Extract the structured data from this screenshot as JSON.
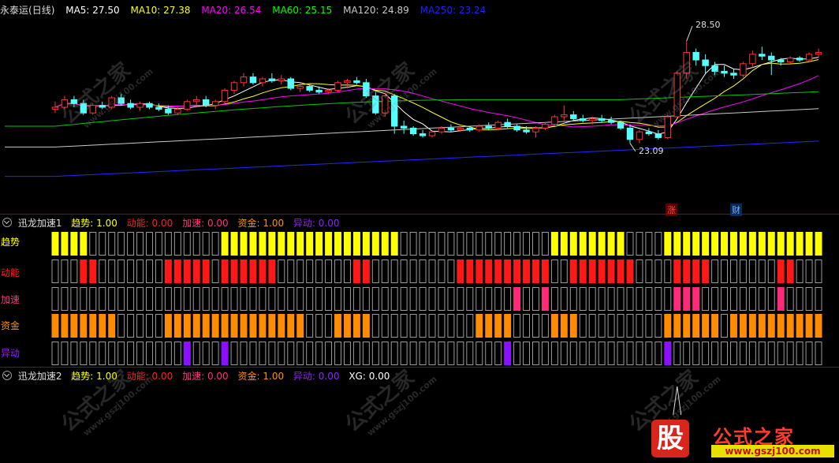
{
  "stock": {
    "name": "永泰运",
    "period": "(日线)"
  },
  "ma_legend": [
    {
      "label": "MA5: 27.50",
      "color": "#ffffff"
    },
    {
      "label": "MA10: 27.38",
      "color": "#ffff00"
    },
    {
      "label": "MA20: 26.54",
      "color": "#ff00ff"
    },
    {
      "label": "MA60: 25.15",
      "color": "#00ff00"
    },
    {
      "label": "MA120: 24.89",
      "color": "#c8c8c8"
    },
    {
      "label": "MA250: 23.24",
      "color": "#2020ff"
    }
  ],
  "annotations": {
    "high": "28.50",
    "low": "23.09",
    "tag_zhang": "涨",
    "tag_cai": "财"
  },
  "panel1": {
    "title": "迅龙加速1",
    "stats": [
      {
        "label": "趋势: 1.00",
        "color": "#ffff00"
      },
      {
        "label": "动能: 0.00",
        "color": "#ff2020"
      },
      {
        "label": "加速: 0.00",
        "color": "#ff3080"
      },
      {
        "label": "资金: 1.00",
        "color": "#ff9000"
      },
      {
        "label": "异动: 0.00",
        "color": "#9020ff"
      }
    ],
    "row_labels": [
      {
        "label": "趋势",
        "color": "#ffff00"
      },
      {
        "label": "动能",
        "color": "#ff2020"
      },
      {
        "label": "加速",
        "color": "#ff3080"
      },
      {
        "label": "资金",
        "color": "#ff9000"
      },
      {
        "label": "异动",
        "color": "#9020ff"
      }
    ]
  },
  "panel2": {
    "title": "迅龙加速2",
    "stats": [
      {
        "label": "趋势: 1.00",
        "color": "#ffff00"
      },
      {
        "label": "动能: 0.00",
        "color": "#ff2020"
      },
      {
        "label": "加速: 0.00",
        "color": "#ff3080"
      },
      {
        "label": "资金: 1.00",
        "color": "#ff9000"
      },
      {
        "label": "异动: 0.00",
        "color": "#9020ff"
      },
      {
        "label": "XG: 0.00",
        "color": "#ffffff"
      }
    ]
  },
  "watermark": {
    "text": "公式之家",
    "url": "www.gszj100.com"
  },
  "logo": {
    "icon_char": "股",
    "name": "公式之家",
    "url": "www.gszj100.com"
  },
  "chart_data": {
    "type": "candlestick",
    "bar_count": 82,
    "ylim": [
      21.0,
      29.5
    ],
    "ohlc": [
      [
        24.9,
        25.3,
        24.7,
        25.0
      ],
      [
        25.0,
        25.6,
        24.9,
        25.4
      ],
      [
        25.4,
        25.6,
        25.0,
        25.2
      ],
      [
        25.2,
        25.4,
        24.6,
        24.7
      ],
      [
        24.7,
        25.2,
        24.6,
        25.1
      ],
      [
        25.1,
        25.3,
        24.9,
        25.0
      ],
      [
        25.0,
        25.6,
        24.9,
        25.5
      ],
      [
        25.5,
        25.7,
        25.1,
        25.2
      ],
      [
        25.2,
        25.4,
        24.9,
        25.0
      ],
      [
        25.0,
        25.3,
        24.8,
        25.2
      ],
      [
        25.2,
        25.3,
        24.9,
        25.0
      ],
      [
        25.0,
        25.2,
        24.8,
        24.9
      ],
      [
        24.9,
        25.1,
        24.6,
        24.7
      ],
      [
        24.7,
        25.0,
        24.6,
        24.9
      ],
      [
        24.9,
        25.4,
        24.8,
        25.3
      ],
      [
        25.3,
        25.6,
        25.1,
        25.4
      ],
      [
        25.4,
        25.6,
        25.0,
        25.1
      ],
      [
        25.1,
        25.4,
        24.9,
        25.3
      ],
      [
        25.3,
        26.0,
        25.2,
        25.9
      ],
      [
        25.9,
        26.4,
        25.7,
        26.3
      ],
      [
        26.3,
        26.8,
        26.1,
        26.6
      ],
      [
        26.6,
        26.8,
        26.2,
        26.3
      ],
      [
        26.3,
        26.6,
        26.1,
        26.5
      ],
      [
        26.5,
        26.8,
        26.3,
        26.4
      ],
      [
        26.4,
        26.7,
        26.2,
        26.5
      ],
      [
        26.5,
        26.6,
        25.9,
        26.0
      ],
      [
        26.0,
        26.3,
        25.8,
        26.1
      ],
      [
        26.1,
        26.2,
        25.8,
        25.9
      ],
      [
        25.9,
        26.1,
        25.7,
        25.8
      ],
      [
        25.8,
        26.0,
        25.7,
        25.9
      ],
      [
        25.9,
        26.4,
        25.8,
        26.3
      ],
      [
        26.3,
        26.5,
        26.0,
        26.4
      ],
      [
        26.4,
        26.6,
        26.2,
        26.3
      ],
      [
        26.3,
        26.5,
        25.5,
        25.6
      ],
      [
        25.6,
        25.8,
        24.6,
        24.7
      ],
      [
        24.7,
        25.8,
        24.5,
        25.6
      ],
      [
        25.6,
        25.7,
        23.6,
        24.0
      ],
      [
        24.0,
        24.3,
        23.6,
        23.9
      ],
      [
        23.9,
        24.0,
        23.5,
        23.6
      ],
      [
        23.6,
        23.8,
        23.4,
        23.5
      ],
      [
        23.5,
        23.8,
        23.4,
        23.7
      ],
      [
        23.7,
        24.0,
        23.6,
        23.9
      ],
      [
        23.9,
        24.1,
        23.7,
        23.8
      ],
      [
        23.8,
        24.0,
        23.7,
        23.9
      ],
      [
        23.9,
        24.0,
        23.7,
        23.8
      ],
      [
        23.8,
        24.1,
        23.7,
        24.0
      ],
      [
        24.0,
        24.2,
        23.8,
        23.9
      ],
      [
        23.9,
        24.3,
        23.8,
        24.2
      ],
      [
        24.2,
        24.4,
        23.9,
        24.0
      ],
      [
        24.0,
        24.1,
        23.7,
        23.8
      ],
      [
        23.8,
        24.0,
        23.6,
        23.7
      ],
      [
        23.7,
        24.0,
        23.4,
        23.9
      ],
      [
        23.9,
        24.2,
        23.8,
        24.1
      ],
      [
        24.1,
        24.6,
        24.0,
        24.5
      ],
      [
        24.5,
        25.1,
        24.3,
        24.6
      ],
      [
        24.6,
        24.8,
        24.3,
        24.4
      ],
      [
        24.4,
        24.6,
        24.2,
        24.3
      ],
      [
        24.3,
        24.5,
        24.1,
        24.4
      ],
      [
        24.4,
        24.6,
        24.2,
        24.3
      ],
      [
        24.3,
        24.5,
        24.1,
        24.2
      ],
      [
        24.2,
        24.3,
        23.8,
        23.9
      ],
      [
        23.9,
        24.1,
        23.1,
        23.3
      ],
      [
        23.3,
        23.8,
        23.1,
        23.7
      ],
      [
        23.7,
        23.9,
        23.5,
        23.6
      ],
      [
        23.6,
        23.8,
        23.3,
        23.4
      ],
      [
        23.4,
        24.6,
        23.3,
        24.5
      ],
      [
        24.5,
        26.9,
        24.4,
        26.8
      ],
      [
        26.8,
        28.5,
        26.5,
        27.9
      ],
      [
        27.9,
        28.1,
        27.2,
        27.5
      ],
      [
        27.5,
        27.8,
        26.8,
        27.2
      ],
      [
        27.2,
        27.4,
        26.7,
        26.9
      ],
      [
        26.9,
        27.2,
        26.6,
        26.8
      ],
      [
        26.8,
        27.0,
        26.5,
        26.7
      ],
      [
        26.7,
        27.4,
        26.6,
        27.3
      ],
      [
        27.3,
        28.0,
        27.1,
        27.8
      ],
      [
        27.8,
        28.2,
        27.5,
        27.7
      ],
      [
        27.7,
        27.9,
        26.7,
        27.5
      ],
      [
        27.5,
        27.6,
        27.2,
        27.4
      ],
      [
        27.4,
        27.7,
        27.3,
        27.6
      ],
      [
        27.6,
        27.7,
        27.4,
        27.5
      ],
      [
        27.5,
        27.9,
        27.4,
        27.8
      ],
      [
        27.8,
        28.1,
        27.6,
        27.9
      ]
    ],
    "signal_rows": [
      {
        "name": "趋势",
        "color": "#ffff00",
        "values": [
          1,
          1,
          1,
          1,
          0,
          0,
          0,
          0,
          0,
          0,
          0,
          0,
          0,
          0,
          0,
          0,
          0,
          0,
          1,
          1,
          1,
          1,
          1,
          1,
          1,
          1,
          1,
          1,
          1,
          1,
          1,
          1,
          1,
          1,
          1,
          1,
          1,
          0,
          0,
          0,
          0,
          0,
          0,
          0,
          0,
          0,
          0,
          0,
          0,
          0,
          0,
          0,
          0,
          1,
          1,
          1,
          1,
          1,
          1,
          1,
          1,
          0,
          0,
          0,
          0,
          1,
          1,
          1,
          1,
          1,
          1,
          1,
          1,
          1,
          1,
          1,
          1,
          1,
          1,
          1,
          1,
          1
        ]
      },
      {
        "name": "动能",
        "color": "#ff1818",
        "values": [
          0,
          0,
          0,
          1,
          1,
          0,
          0,
          0,
          0,
          0,
          0,
          0,
          1,
          1,
          1,
          1,
          1,
          0,
          1,
          1,
          1,
          1,
          1,
          1,
          0,
          0,
          0,
          0,
          0,
          0,
          0,
          0,
          1,
          1,
          0,
          0,
          0,
          0,
          0,
          0,
          0,
          0,
          0,
          1,
          1,
          1,
          1,
          1,
          1,
          1,
          1,
          1,
          1,
          0,
          0,
          1,
          1,
          1,
          1,
          1,
          1,
          1,
          0,
          0,
          0,
          0,
          1,
          1,
          1,
          1,
          0,
          0,
          0,
          0,
          0,
          0,
          0,
          1,
          1,
          0,
          0,
          0
        ]
      },
      {
        "name": "加速",
        "color": "#ff2a7a",
        "values": [
          0,
          0,
          0,
          0,
          0,
          0,
          0,
          0,
          0,
          0,
          0,
          0,
          0,
          0,
          0,
          0,
          0,
          0,
          0,
          0,
          0,
          0,
          0,
          0,
          0,
          0,
          0,
          0,
          0,
          0,
          0,
          0,
          0,
          0,
          0,
          0,
          0,
          0,
          0,
          0,
          0,
          0,
          0,
          0,
          0,
          0,
          0,
          0,
          0,
          1,
          0,
          0,
          1,
          0,
          0,
          0,
          0,
          0,
          0,
          0,
          0,
          0,
          0,
          0,
          0,
          0,
          1,
          1,
          1,
          0,
          0,
          0,
          0,
          0,
          0,
          0,
          0,
          1,
          0,
          0,
          0,
          0
        ]
      },
      {
        "name": "资金",
        "color": "#ff8c00",
        "values": [
          1,
          1,
          1,
          1,
          1,
          1,
          1,
          0,
          0,
          0,
          0,
          0,
          1,
          1,
          1,
          1,
          1,
          1,
          1,
          1,
          1,
          1,
          1,
          1,
          1,
          1,
          1,
          0,
          0,
          0,
          1,
          1,
          1,
          1,
          0,
          0,
          0,
          0,
          0,
          0,
          0,
          0,
          0,
          0,
          0,
          1,
          1,
          1,
          1,
          0,
          0,
          0,
          0,
          1,
          1,
          1,
          0,
          0,
          0,
          0,
          0,
          0,
          0,
          0,
          0,
          1,
          1,
          1,
          1,
          1,
          1,
          0,
          1,
          1,
          1,
          1,
          1,
          1,
          1,
          1,
          1,
          1
        ]
      },
      {
        "name": "异动",
        "color": "#8a10ff",
        "values": [
          0,
          0,
          0,
          0,
          0,
          0,
          0,
          0,
          0,
          0,
          0,
          0,
          0,
          0,
          1,
          0,
          0,
          0,
          1,
          0,
          0,
          0,
          0,
          0,
          0,
          0,
          0,
          0,
          0,
          0,
          0,
          0,
          0,
          0,
          0,
          0,
          0,
          0,
          0,
          0,
          0,
          0,
          0,
          0,
          0,
          0,
          0,
          0,
          1,
          0,
          0,
          0,
          0,
          0,
          0,
          0,
          0,
          0,
          0,
          0,
          0,
          0,
          0,
          0,
          0,
          1,
          0,
          0,
          0,
          0,
          0,
          0,
          0,
          0,
          0,
          0,
          0,
          0,
          0,
          0,
          0,
          0
        ]
      }
    ]
  }
}
